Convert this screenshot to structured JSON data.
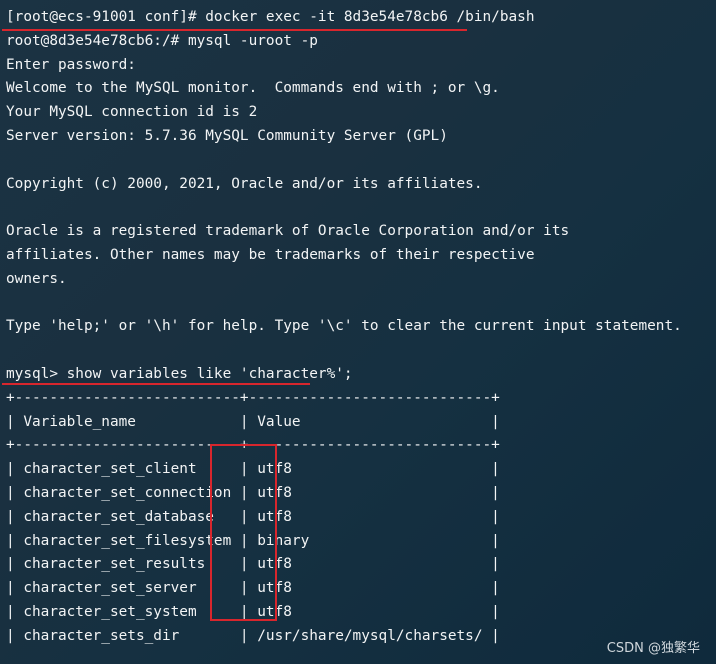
{
  "terminal": {
    "lines": [
      "[root@ecs-91001 conf]# docker exec -it 8d3e54e78cb6 /bin/bash",
      "root@8d3e54e78cb6:/# mysql -uroot -p",
      "Enter password:",
      "Welcome to the MySQL monitor.  Commands end with ; or \\g.",
      "Your MySQL connection id is 2",
      "Server version: 5.7.36 MySQL Community Server (GPL)",
      "",
      "Copyright (c) 2000, 2021, Oracle and/or its affiliates.",
      "",
      "Oracle is a registered trademark of Oracle Corporation and/or its",
      "affiliates. Other names may be trademarks of their respective",
      "owners.",
      "",
      "Type 'help;' or '\\h' for help. Type '\\c' to clear the current input statement.",
      "",
      "mysql> show variables like 'character%';",
      "+--------------------------+----------------------------+",
      "| Variable_name            | Value                      |",
      "+--------------------------+----------------------------+",
      "| character_set_client     | utf8                       |",
      "| character_set_connection | utf8                       |",
      "| character_set_database   | utf8                       |",
      "| character_set_filesystem | binary                     |",
      "| character_set_results    | utf8                       |",
      "| character_set_server     | utf8                       |",
      "| character_set_system     | utf8                       |",
      "| character_sets_dir       | /usr/share/mysql/charsets/ |"
    ]
  },
  "watermark": "CSDN @独繁华",
  "colors": {
    "text": "#f2f4f5",
    "highlight": "#d8262d",
    "background": "#1a3040"
  }
}
